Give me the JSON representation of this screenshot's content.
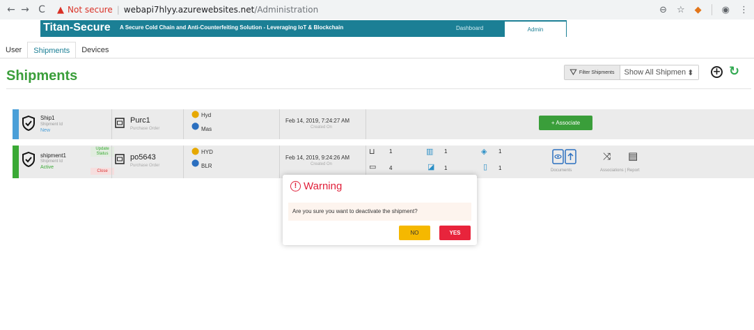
{
  "browser": {
    "back": "←",
    "forward": "→",
    "reload": "C",
    "not_secure": "Not secure",
    "url_host": "webapi7hlyy.azurewebsites.net",
    "url_path": "/Administration"
  },
  "header": {
    "brand": "Titan-Secure",
    "tagline": "A Secure Cold Chain and Anti-Counterfeiting Solution - Leveraging IoT & Blockchain",
    "nav": {
      "dashboard": "Dashboard",
      "admin": "Admin"
    },
    "colors": {
      "primary": "#1b7f95"
    }
  },
  "tabs": {
    "user": "User",
    "shipments": "Shipments",
    "devices": "Devices"
  },
  "page": {
    "title": "Shipments",
    "filter_label": "Filter Shipments",
    "filter_value": "Show All Shipmen",
    "colors": {
      "title": "#3a9e3a"
    }
  },
  "shipments": [
    {
      "name": "Ship1",
      "id_label": "Shipment Id",
      "status": "New",
      "po": "Purc1",
      "po_label": "Purchase Order",
      "from": "Hyd",
      "to": "Mas",
      "date": "Feb 14, 2019, 7:24:27 AM",
      "date_label": "Created On",
      "associate": "+ Associate",
      "color": "#4a9fd8"
    },
    {
      "name": "shipment1",
      "id_label": "Shipment Id",
      "status": "Active",
      "update_status": "Update Status",
      "close": "Close",
      "po": "po5643",
      "po_label": "Purchase Order",
      "from": "HYD",
      "to": "BLR",
      "date": "Feb 14, 2019, 9:24:26 AM",
      "date_label": "Created On",
      "devices": {
        "d1": "1",
        "d2": "4",
        "d3": "1",
        "d4": "1",
        "d5": "1",
        "d6": "1"
      },
      "documents": "Documents",
      "assoc_report": "Associations | Report",
      "color": "#3aa935"
    }
  ],
  "modal": {
    "title": "Warning",
    "message": "Are you sure you want to deactivate the shipment?",
    "no": "NO",
    "yes": "YES",
    "colors": {
      "no": "#f5b800",
      "yes": "#e8243c"
    }
  }
}
